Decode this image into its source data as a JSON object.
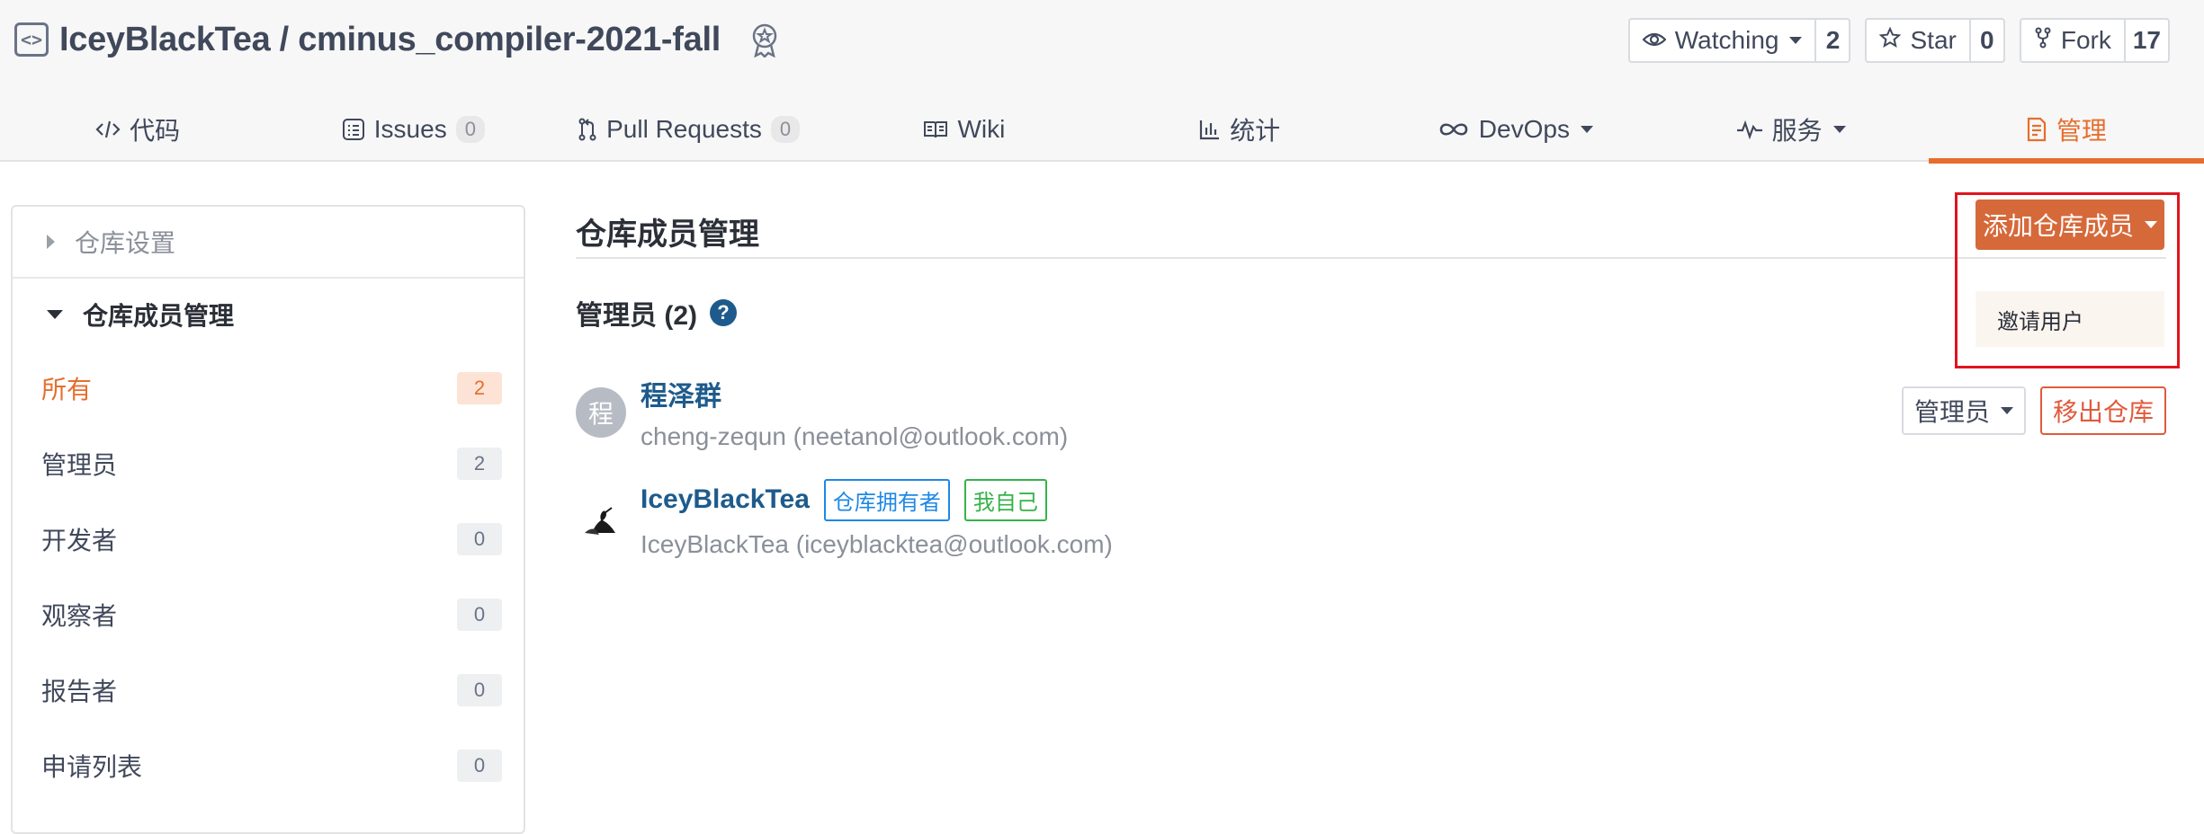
{
  "repo": {
    "icon": "code-repo-icon",
    "title": "IceyBlackTea / cminus_compiler-2021-fall",
    "badge_icon": "award-badge-icon"
  },
  "actions": {
    "watch": {
      "label": "Watching",
      "count": "2",
      "icon": "eye-icon"
    },
    "star": {
      "label": "Star",
      "count": "0",
      "icon": "star-icon"
    },
    "fork": {
      "label": "Fork",
      "count": "17",
      "icon": "fork-icon"
    }
  },
  "tabs": [
    {
      "label": "代码",
      "icon": "code-icon"
    },
    {
      "label": "Issues",
      "count": "0",
      "icon": "issue-icon"
    },
    {
      "label": "Pull Requests",
      "count": "0",
      "icon": "pull-request-icon"
    },
    {
      "label": "Wiki",
      "icon": "book-icon"
    },
    {
      "label": "统计",
      "icon": "bar-chart-icon"
    },
    {
      "label": "DevOps",
      "icon": "infinity-icon"
    },
    {
      "label": "服务",
      "icon": "pulse-icon"
    },
    {
      "label": "管理",
      "icon": "document-icon",
      "active": true
    }
  ],
  "sidebar": {
    "settings": "仓库设置",
    "members": "仓库成员管理",
    "items": [
      {
        "label": "所有",
        "count": "2",
        "active": true
      },
      {
        "label": "管理员",
        "count": "2"
      },
      {
        "label": "开发者",
        "count": "0"
      },
      {
        "label": "观察者",
        "count": "0"
      },
      {
        "label": "报告者",
        "count": "0"
      },
      {
        "label": "申请列表",
        "count": "0"
      }
    ]
  },
  "main": {
    "title": "仓库成员管理",
    "add_button": "添加仓库成员",
    "dropdown_item": "邀请用户",
    "group_title": "管理员 (2)",
    "members": [
      {
        "avatar_char": "程",
        "name": "程泽群",
        "sub": "cheng-zequn (neetanol@outlook.com)",
        "role": "管理员",
        "remove": "移出仓库"
      },
      {
        "name": "IceyBlackTea",
        "tag_owner": "仓库拥有者",
        "tag_self": "我自己",
        "sub": "IceyBlackTea (iceyblacktea@outlook.com)"
      }
    ]
  },
  "colors": {
    "accent": "#e66e2d",
    "link": "#1e5b8c",
    "highlight": "#e0141e"
  }
}
